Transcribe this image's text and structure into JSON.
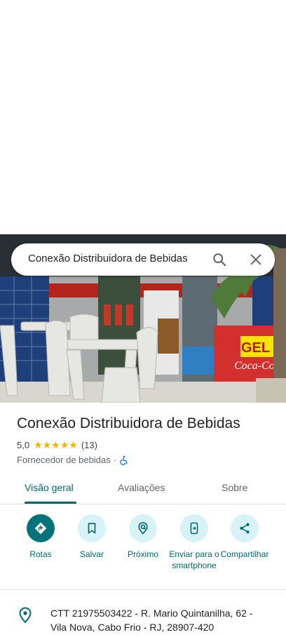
{
  "search": {
    "query": "Conexão Distribuidora de Bebidas"
  },
  "place": {
    "name": "Conexão Distribuidora de Bebidas",
    "rating": "5,0",
    "stars": "★★★★★",
    "review_count": "(13)",
    "category": "Fornecedor de bebidas",
    "separator": "·"
  },
  "tabs": [
    {
      "label": "Visão geral"
    },
    {
      "label": "Avaliações"
    },
    {
      "label": "Sobre"
    }
  ],
  "actions": [
    {
      "label": "Rotas",
      "icon": "directions-icon"
    },
    {
      "label": "Salvar",
      "icon": "bookmark-icon"
    },
    {
      "label": "Próximo",
      "icon": "nearby-icon"
    },
    {
      "label": "Enviar para o smartphone",
      "icon": "send-to-phone-icon"
    },
    {
      "label": "Compartilhar",
      "icon": "share-icon"
    }
  ],
  "address": "CTT 21975503422 - R. Mario Quintanilha, 62 - Vila Nova, Cabo Frio - RJ, 28907-420",
  "colors": {
    "accent": "#00696f",
    "primary_button": "#00727a",
    "button_bg": "#d7f3f7",
    "star": "#f4b400"
  }
}
